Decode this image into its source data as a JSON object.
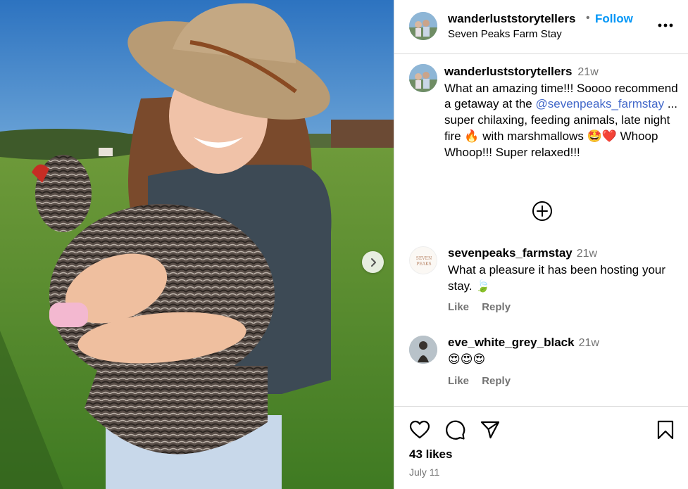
{
  "post": {
    "username": "wanderluststorytellers",
    "follow_label": "Follow",
    "location": "Seven Peaks Farm Stay",
    "dot": "•"
  },
  "caption": {
    "username": "wanderluststorytellers",
    "time": "21w",
    "text_before": "What an amazing time!!! Soooo recommend a getaway at the ",
    "mention": "@sevenpeaks_farmstay",
    "text_after": " ... super chilaxing, feeding animals, late night fire 🔥 with marshmallows 🤩❤️ Whoop Whoop!!! Super relaxed!!!"
  },
  "comments": [
    {
      "username": "sevenpeaks_farmstay",
      "time": "21w",
      "text": "What a pleasure it has been hosting your stay. 🍃",
      "like_label": "Like",
      "reply_label": "Reply",
      "avatar_logo_text": "SEVEN PEAKS"
    },
    {
      "username": "eve_white_grey_black",
      "time": "21w",
      "text": "😍😍😍",
      "like_label": "Like",
      "reply_label": "Reply"
    }
  ],
  "footer": {
    "likes": "43 likes",
    "date": "July 11"
  },
  "icons": {
    "more": "more-horizontal-icon",
    "add_comment": "plus-circle-icon",
    "like": "heart-icon",
    "comment": "comment-icon",
    "share": "send-icon",
    "save": "bookmark-icon",
    "carousel_next": "chevron-right-icon"
  },
  "colors": {
    "accent": "#0095f6",
    "mention": "#4167c9",
    "secondary_text": "#737373",
    "divider": "#dbdbdb"
  }
}
